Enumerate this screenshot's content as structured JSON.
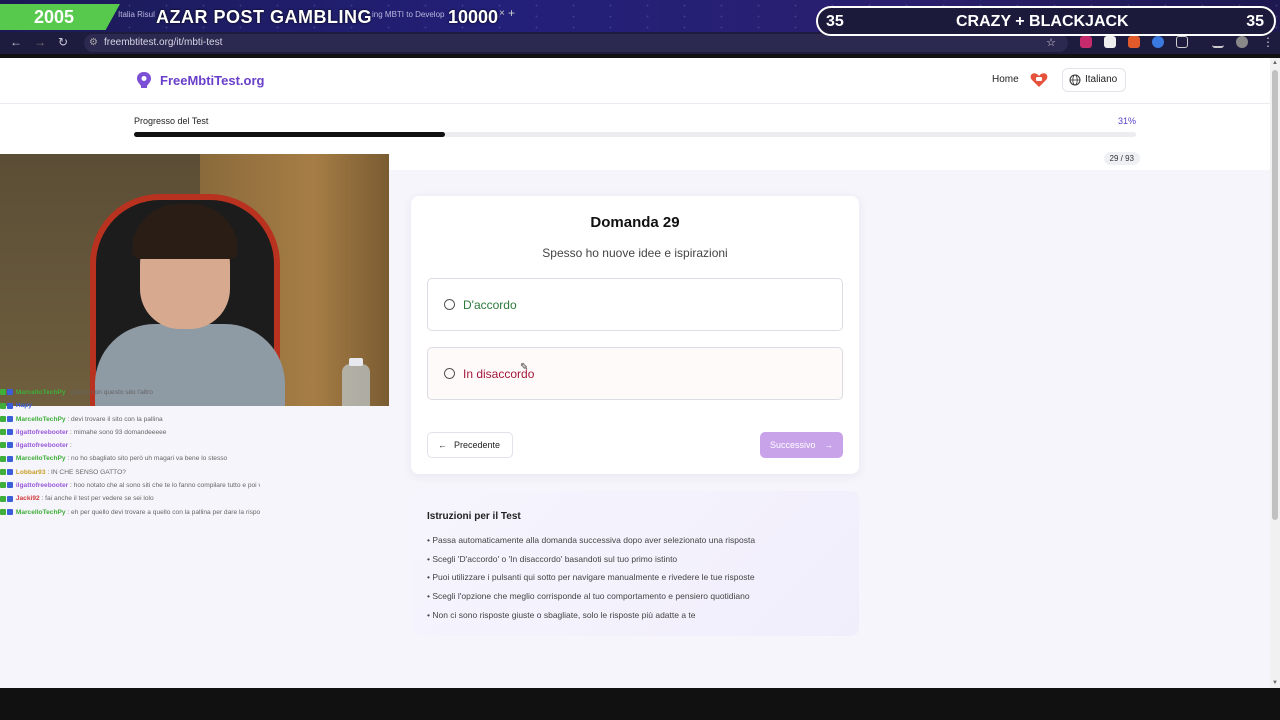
{
  "browser": {
    "tab_title_left": "Italia Risul",
    "tab_title_right": "ing MBTI to Develop",
    "tab_close": "×",
    "tab_plus": "+",
    "url": "freembtitest.org/it/mbti-test"
  },
  "stream_overlay": {
    "year": "2005",
    "title": "AZAR POST GAMBLING",
    "counter": "10000",
    "right_left_num": "35",
    "right_title": "CRAZY + BLACKJACK",
    "right_right_num": "35",
    "colors": {
      "year_bg": "#57c94c"
    }
  },
  "header": {
    "logo": "FreeMbtiTest.org",
    "nav_home": "Home",
    "language": "Italiano"
  },
  "progress": {
    "label": "Progresso del Test",
    "percent_text": "31%",
    "fraction": 0.31,
    "count": "29 / 93"
  },
  "question": {
    "title": "Domanda 29",
    "text": "Spesso ho nuove idee e ispirazioni",
    "option_agree": "D'accordo",
    "option_disagree": "In disaccordo",
    "prev_label": "Precedente",
    "next_label": "Successivo"
  },
  "instructions": {
    "title": "Istruzioni per il Test",
    "items": [
      "• Passa automaticamente alla domanda successiva dopo aver selezionato una risposta",
      "• Scegli 'D'accordo' o 'In disaccordo' basandoti sul tuo primo istinto",
      "• Puoi utilizzare i pulsanti qui sotto per navigare manualmente e rivedere le tue risposte",
      "• Scegli l'opzione che meglio corrisponde al tuo comportamento e pensiero quotidiano",
      "• Non ci sono risposte giuste o sbagliate, solo le risposte più adatte a te"
    ]
  },
  "chat": [
    {
      "user": "MarcelloTechPy",
      "color": "#3fae3a",
      "msg": ": ghens non questo sito l'altro"
    },
    {
      "user": "Hapy",
      "color": "#3b5ed8",
      "msg": ""
    },
    {
      "user": "MarcelloTechPy",
      "color": "#3fae3a",
      "msg": ": devi trovare il sito con la pallina"
    },
    {
      "user": "ilgattofreebooter",
      "color": "#9a5ad8",
      "msg": ": mimahe sono 93 domandeeeee"
    },
    {
      "user": "ilgattofreebooter",
      "color": "#9a5ad8",
      "msg": ":"
    },
    {
      "user": "MarcelloTechPy",
      "color": "#3fae3a",
      "msg": ": no ho sbagliato sito però uh magari va bene lo stesso"
    },
    {
      "user": "Lobbar93",
      "color": "#c8a02a",
      "msg": ": IN CHE SENSO GATTO?"
    },
    {
      "user": "ilgattofreebooter",
      "color": "#9a5ad8",
      "msg": ": hoo notato che al sono siti che te lo fanno compilare tutto e poi vogliono i soldi per vedere il risultato"
    },
    {
      "user": "Jacki92",
      "color": "#d23b3b",
      "msg": ": fai anche il test per vedere se sei lolo"
    },
    {
      "user": "MarcelloTechPy",
      "color": "#3fae3a",
      "msg": ": eh per quello devi trovare a quello con la pallina per dare la risposta alle domande così puoi scegliere quanto sei d'accordo oppure in disaccordo"
    }
  ]
}
